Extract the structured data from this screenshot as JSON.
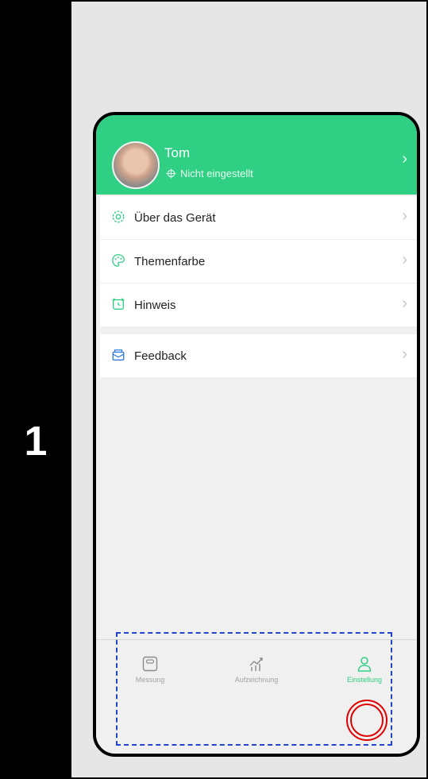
{
  "step": {
    "number": "1"
  },
  "profile": {
    "name": "Tom",
    "location_status": "Nicht eingestellt",
    "chevron": "›"
  },
  "menu": {
    "group1": [
      {
        "label": "Über das Gerät",
        "icon": "gear-icon"
      },
      {
        "label": "Themenfarbe",
        "icon": "palette-icon"
      },
      {
        "label": "Hinweis",
        "icon": "alarm-clock-icon"
      }
    ],
    "group2": [
      {
        "label": "Feedback",
        "icon": "mail-icon"
      }
    ],
    "chevron": "›"
  },
  "tabbar": {
    "tabs": [
      {
        "label": "Messung",
        "icon": "scale-icon"
      },
      {
        "label": "Aufzeichnung",
        "icon": "chart-icon"
      },
      {
        "label": "Einstellung",
        "icon": "person-icon",
        "active": true
      }
    ]
  },
  "colors": {
    "accent": "#2fcf84",
    "highlight_ring": "#e00000",
    "highlight_box": "#2244cc"
  }
}
